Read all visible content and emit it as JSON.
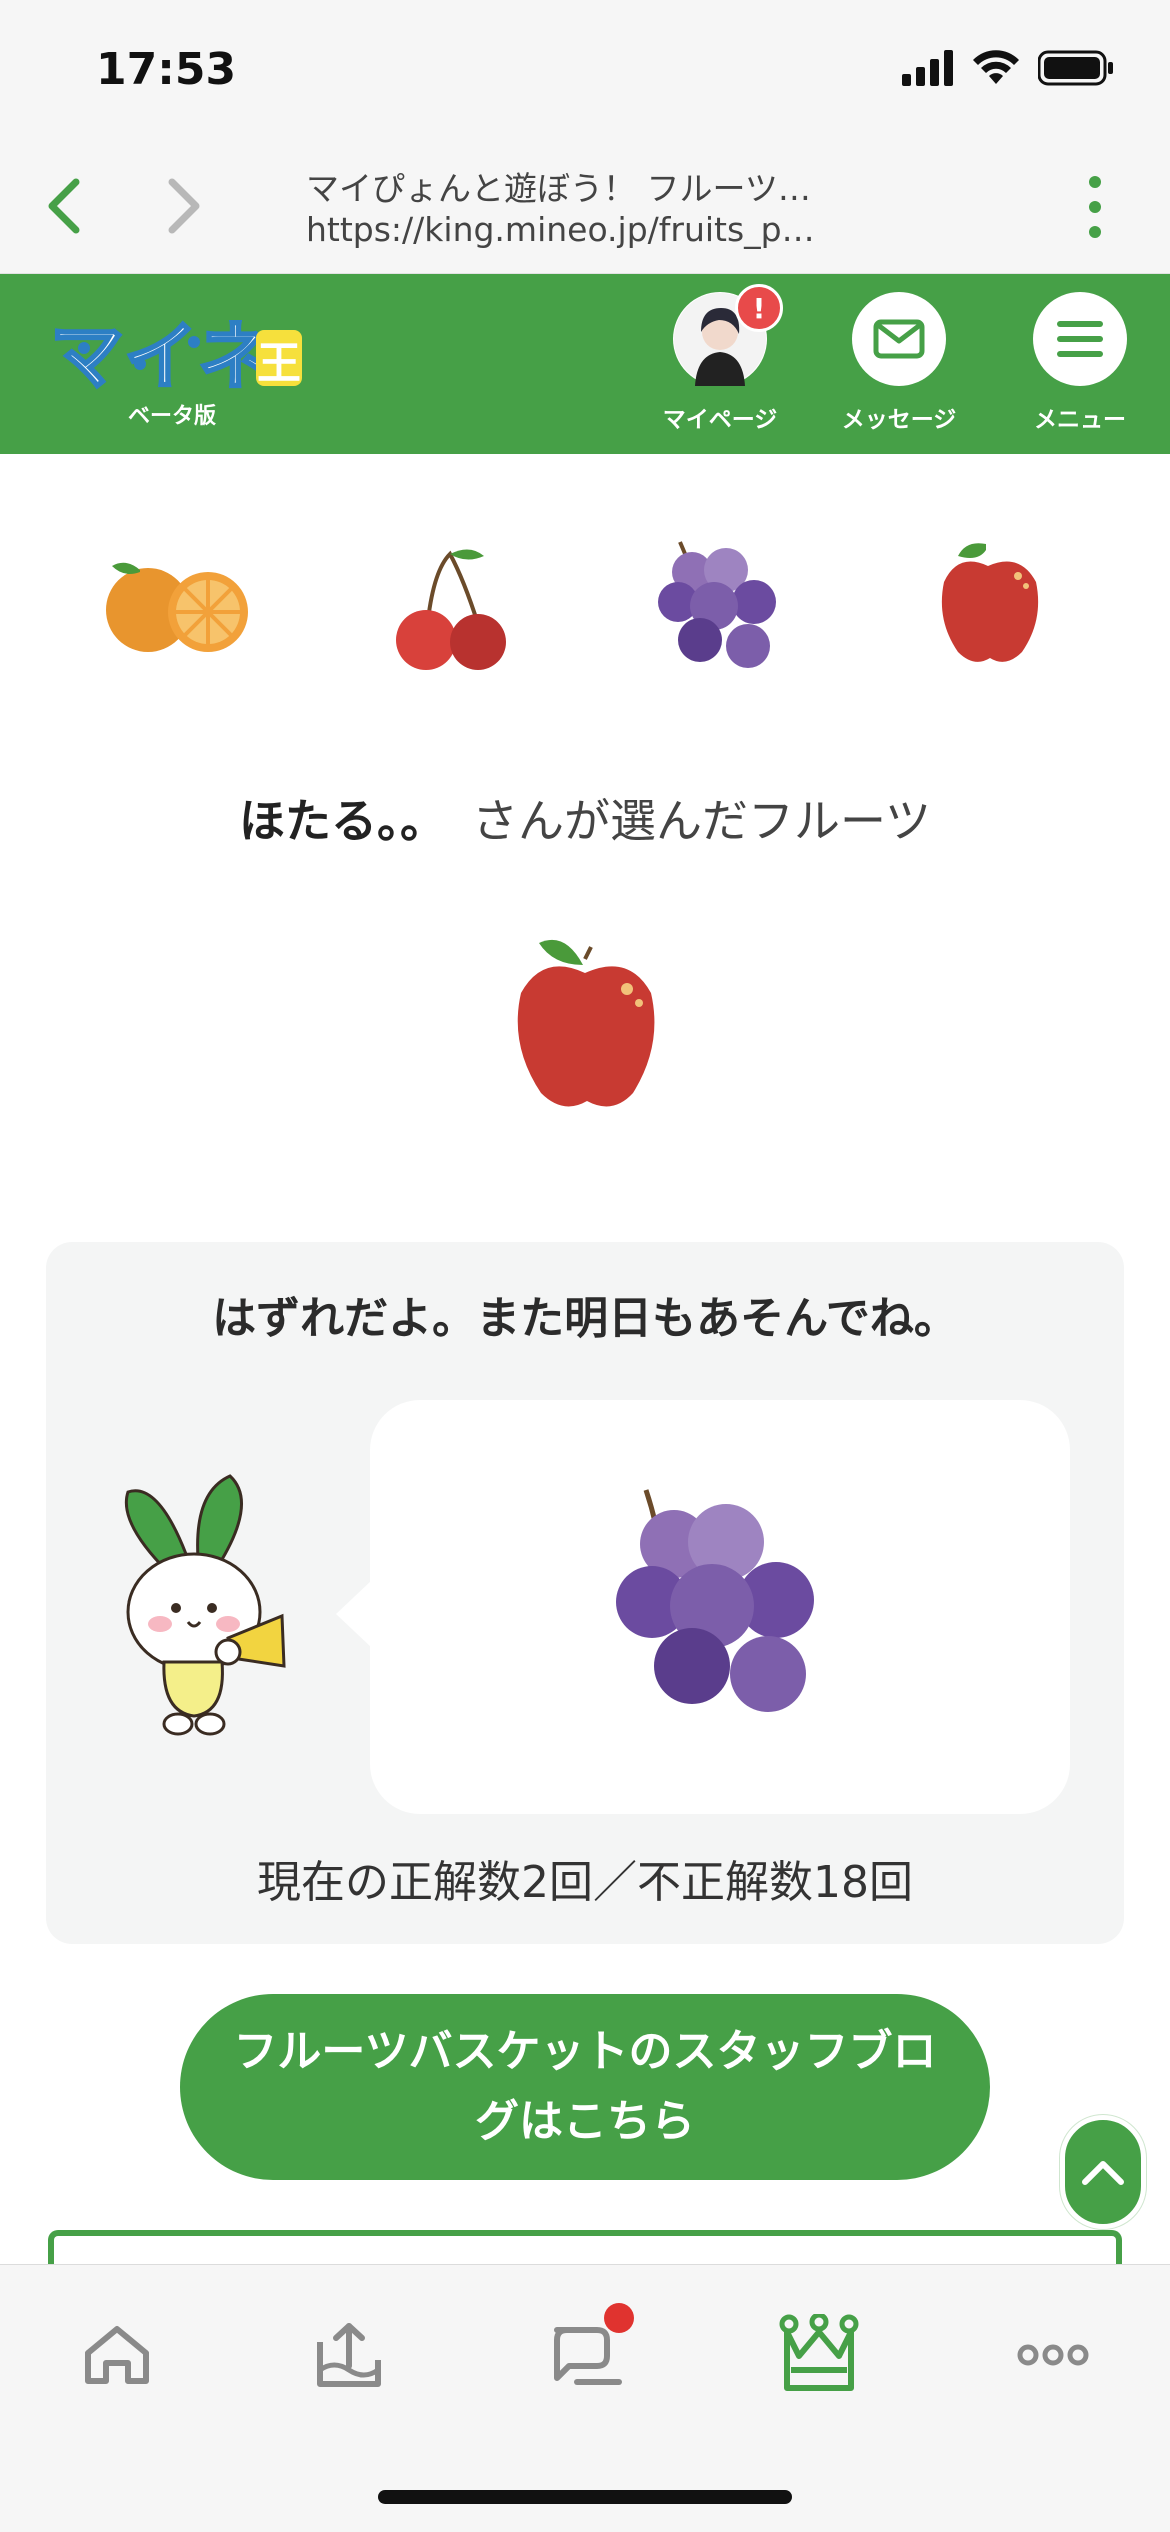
{
  "status_bar": {
    "time": "17:53"
  },
  "browser": {
    "title": "マイぴょんと遊ぼう！ フルーツ…",
    "url": "https://king.mineo.jp/fruits_p…"
  },
  "header": {
    "logo_text": "マイネ王",
    "logo_sub": "ベータ版",
    "mypage_label": "マイページ",
    "mypage_badge": "!",
    "message_label": "メッセージ",
    "menu_label": "メニュー",
    "accent": "#46a047"
  },
  "fruits": [
    "orange-icon",
    "cherry-icon",
    "grape-icon",
    "apple-icon"
  ],
  "chosen": {
    "name": "ほたる。。",
    "suffix": "さんが選んだフルーツ",
    "fruit": "apple-icon"
  },
  "result": {
    "message": "はずれだよ。また明日もあそんでね。",
    "mascot_fruit": "grape-icon",
    "score": "現在の正解数2回／不正解数18回"
  },
  "blog_button": {
    "label": "フルーツバスケットのスタッフブログはこちら"
  },
  "tab_bar": {
    "items": [
      "home-icon",
      "upload-icon",
      "chat-icon",
      "crown-icon",
      "more-icon"
    ],
    "active": "crown-icon",
    "notification_color": "#e0332f"
  }
}
